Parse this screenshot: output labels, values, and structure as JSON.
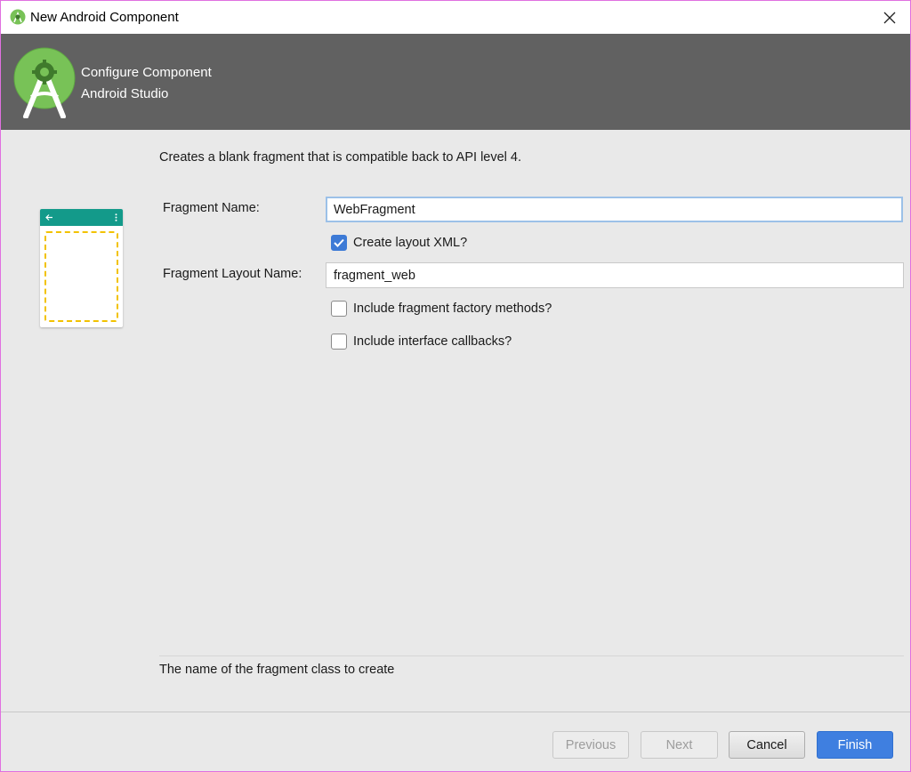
{
  "window": {
    "title": "New Android Component",
    "close_icon": "close-icon"
  },
  "banner": {
    "line1": "Configure Component",
    "line2": "Android Studio",
    "logo_icon": "android-studio-logo"
  },
  "main": {
    "description": "Creates a blank fragment that is compatible back to API level 4.",
    "fragment_name": {
      "label": "Fragment Name:",
      "value": "WebFragment"
    },
    "create_layout_xml": {
      "label": "Create layout XML?",
      "checked": true
    },
    "fragment_layout_name": {
      "label": "Fragment Layout Name:",
      "value": "fragment_web"
    },
    "include_factory_methods": {
      "label": "Include fragment factory methods?",
      "checked": false
    },
    "include_interface_callbacks": {
      "label": "Include interface callbacks?",
      "checked": false
    },
    "hint": "The name of the fragment class to create"
  },
  "footer": {
    "previous_label": "Previous",
    "next_label": "Next",
    "cancel_label": "Cancel",
    "finish_label": "Finish"
  },
  "colors": {
    "banner": "#616161",
    "preview_bar": "#139a8a",
    "checkbox_checked": "#3d7ad6",
    "primary_button": "#3f7fe0"
  }
}
